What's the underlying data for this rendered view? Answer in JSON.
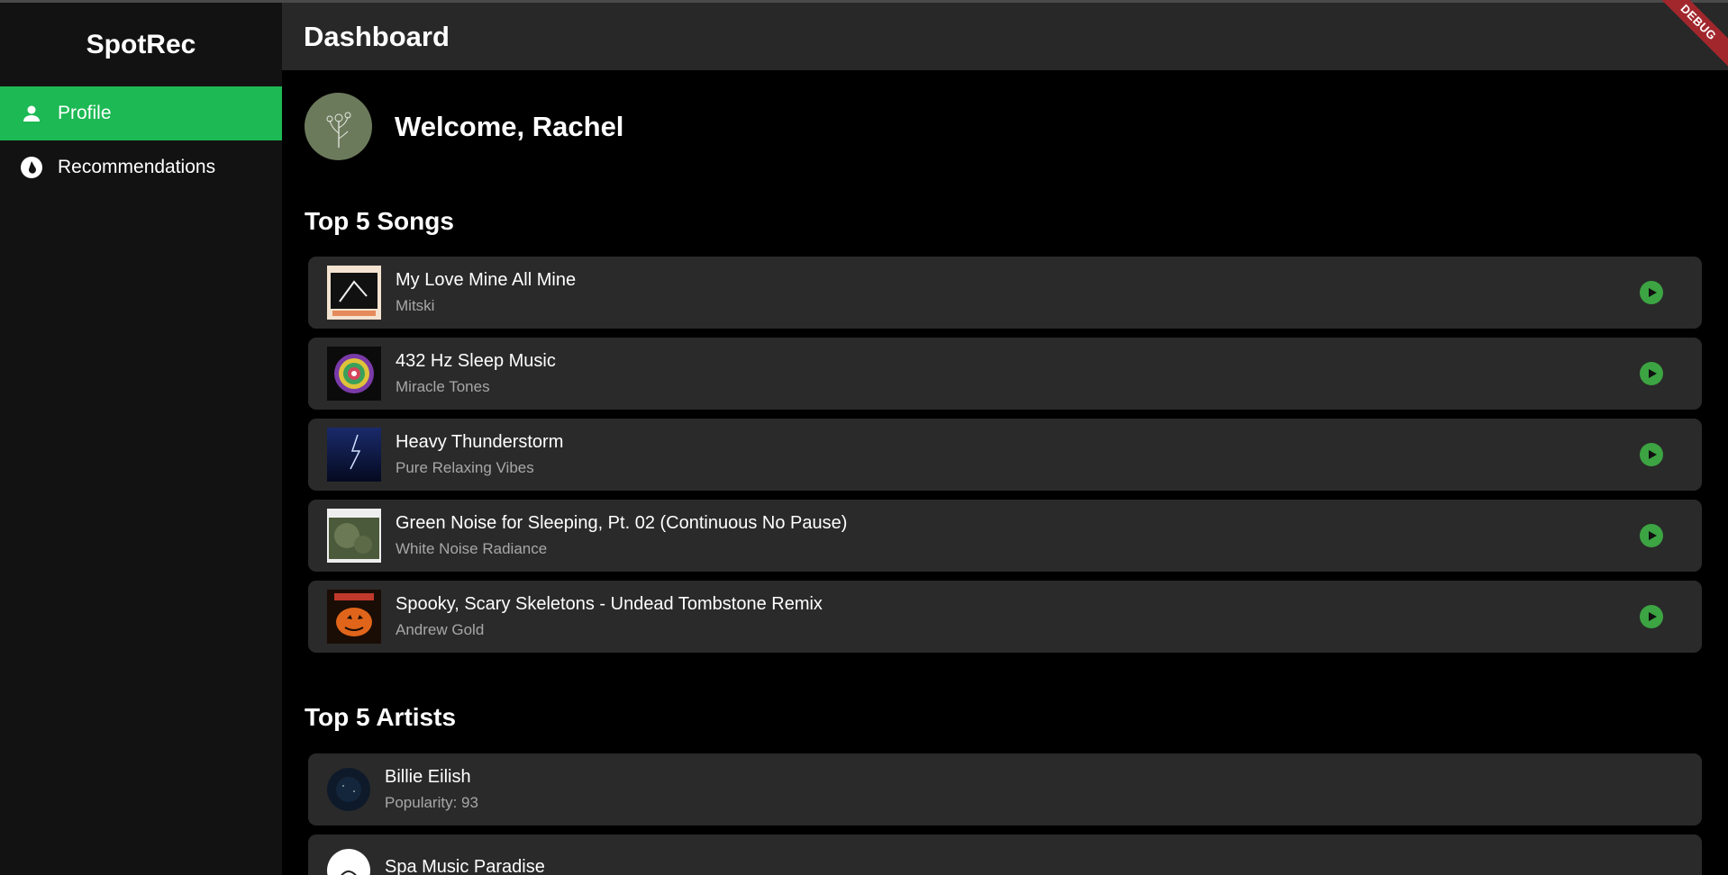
{
  "app": {
    "name": "SpotRec",
    "debug_label": "DEBUG"
  },
  "sidebar": {
    "items": [
      {
        "label": "Profile",
        "icon": "person-icon",
        "active": true
      },
      {
        "label": "Recommendations",
        "icon": "recommendations-icon",
        "active": false
      }
    ]
  },
  "header": {
    "title": "Dashboard"
  },
  "welcome": {
    "text": "Welcome, Rachel"
  },
  "songs": {
    "title": "Top 5 Songs",
    "items": [
      {
        "title": "My Love Mine All Mine",
        "artist": "Mitski"
      },
      {
        "title": "432 Hz Sleep Music",
        "artist": "Miracle Tones"
      },
      {
        "title": "Heavy Thunderstorm",
        "artist": "Pure Relaxing Vibes"
      },
      {
        "title": "Green Noise for Sleeping, Pt. 02 (Continuous No Pause)",
        "artist": "White Noise Radiance"
      },
      {
        "title": "Spooky, Scary Skeletons - Undead Tombstone Remix",
        "artist": "Andrew Gold"
      }
    ]
  },
  "artists": {
    "title": "Top 5 Artists",
    "items": [
      {
        "name": "Billie Eilish",
        "popularity": "Popularity: 93"
      },
      {
        "name": "Spa Music Paradise",
        "popularity": ""
      }
    ]
  },
  "colors": {
    "accent": "#1db954",
    "play": "#3ca442",
    "card": "#2a2a2a",
    "header": "#282828",
    "sidebar": "#121212"
  }
}
